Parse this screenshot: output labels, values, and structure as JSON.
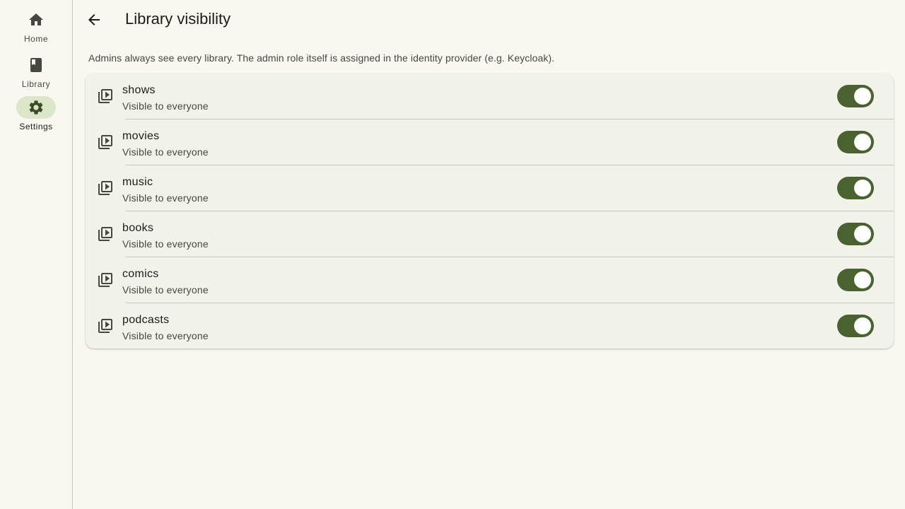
{
  "nav": {
    "items": [
      {
        "label": "Home",
        "icon": "home-icon",
        "active": false
      },
      {
        "label": "Library",
        "icon": "book-icon",
        "active": false
      },
      {
        "label": "Settings",
        "icon": "gear-icon",
        "active": true
      }
    ]
  },
  "header": {
    "title": "Library visibility",
    "back_icon": "arrow-back-icon"
  },
  "description": "Admins always see every library. The admin role itself is assigned in the identity provider (e.g. Keycloak).",
  "libraries": [
    {
      "name": "shows",
      "visibility": "Visible to everyone",
      "enabled": true
    },
    {
      "name": "movies",
      "visibility": "Visible to everyone",
      "enabled": true
    },
    {
      "name": "music",
      "visibility": "Visible to everyone",
      "enabled": true
    },
    {
      "name": "books",
      "visibility": "Visible to everyone",
      "enabled": true
    },
    {
      "name": "comics",
      "visibility": "Visible to everyone",
      "enabled": true
    },
    {
      "name": "podcasts",
      "visibility": "Visible to everyone",
      "enabled": true
    }
  ],
  "colors": {
    "background": "#f8f8f1",
    "card": "#f1f2ea",
    "accent": "#4a6130",
    "active_indicator": "#dbe7c8"
  }
}
